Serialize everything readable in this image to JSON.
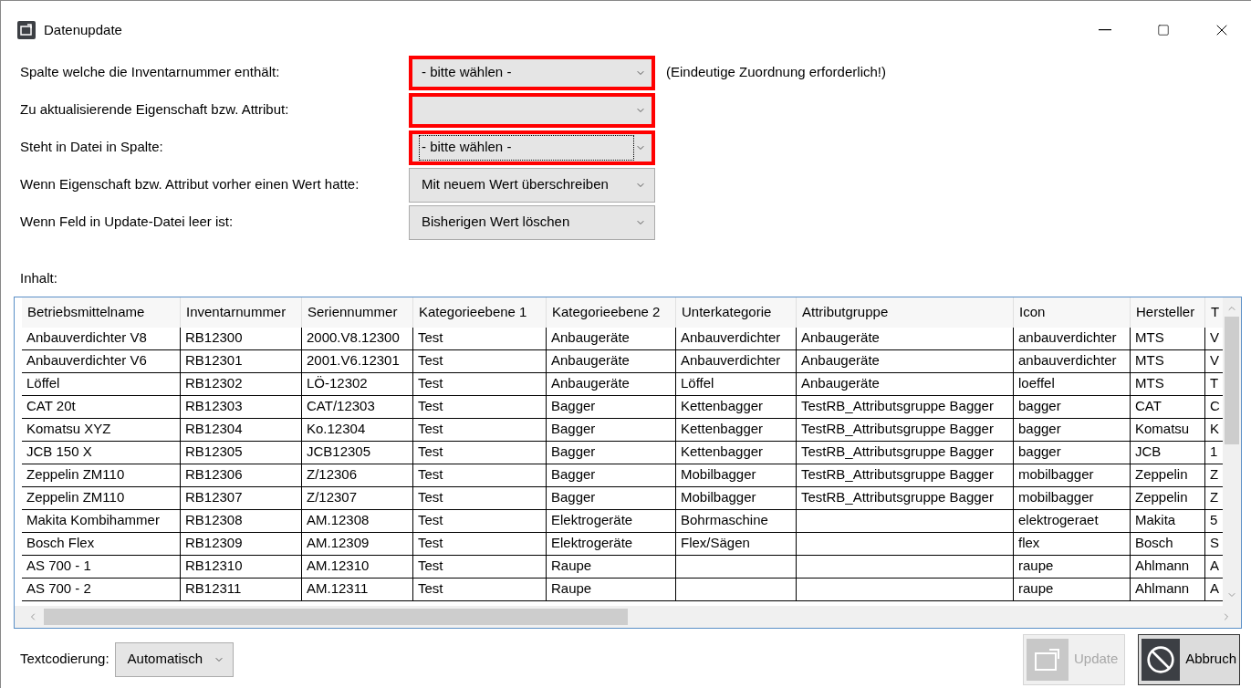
{
  "window": {
    "title": "Datenupdate"
  },
  "form": [
    {
      "label": "Spalte welche die Inventarnummer enthält:",
      "value": "- bitte wählen -",
      "invalid": true,
      "focused": false,
      "note": "(Eindeutige Zuordnung erforderlich!)"
    },
    {
      "label": "Zu aktualisierende Eigenschaft bzw. Attribut:",
      "invalid": true,
      "focused": false
    },
    {
      "label": "Steht in Datei in Spalte:",
      "value": "- bitte wählen -",
      "invalid": true,
      "focused": true
    },
    {
      "label": "Wenn Eigenschaft bzw. Attribut vorher einen Wert hatte:",
      "value": "Mit neuem Wert überschreiben",
      "invalid": false,
      "focused": false
    },
    {
      "label": "Wenn Feld in Update-Datei leer ist:",
      "value": "Bisherigen Wert löschen",
      "invalid": false,
      "focused": false
    }
  ],
  "content_label": "Inhalt:",
  "table": {
    "columns": [
      "Betriebsmittelname",
      "Inventarnummer",
      "Seriennummer",
      "Kategorieebene 1",
      "Kategorieebene 2",
      "Unterkategorie",
      "Attributgruppe",
      "Icon",
      "Hersteller",
      "T"
    ],
    "rows": [
      [
        "Anbauverdichter V8",
        "RB12300",
        "2000.V8.12300",
        "Test",
        "Anbaugeräte",
        "Anbauverdichter",
        "Anbaugeräte",
        "anbauverdichter",
        "MTS",
        "V"
      ],
      [
        "Anbauverdichter V6",
        "RB12301",
        "2001.V6.12301",
        "Test",
        "Anbaugeräte",
        "Anbauverdichter",
        "Anbaugeräte",
        "anbauverdichter",
        "MTS",
        "V"
      ],
      [
        "Löffel",
        "RB12302",
        "LÖ-12302",
        "Test",
        "Anbaugeräte",
        "Löffel",
        "Anbaugeräte",
        "loeffel",
        "MTS",
        "T"
      ],
      [
        "CAT 20t",
        "RB12303",
        "CAT/12303",
        "Test",
        "Bagger",
        "Kettenbagger",
        "TestRB_Attributsgruppe Bagger",
        "bagger",
        "CAT",
        "C"
      ],
      [
        "Komatsu XYZ",
        "RB12304",
        "Ko.12304",
        "Test",
        "Bagger",
        "Kettenbagger",
        "TestRB_Attributsgruppe Bagger",
        "bagger",
        "Komatsu",
        "K"
      ],
      [
        "JCB 150 X",
        "RB12305",
        "JCB12305",
        "Test",
        "Bagger",
        "Kettenbagger",
        "TestRB_Attributsgruppe Bagger",
        "bagger",
        "JCB",
        "1"
      ],
      [
        "Zeppelin ZM110",
        "RB12306",
        "Z/12306",
        "Test",
        "Bagger",
        "Mobilbagger",
        "TestRB_Attributsgruppe Bagger",
        "mobilbagger",
        "Zeppelin",
        "Z"
      ],
      [
        "Zeppelin ZM110",
        "RB12307",
        "Z/12307",
        "Test",
        "Bagger",
        "Mobilbagger",
        "TestRB_Attributsgruppe Bagger",
        "mobilbagger",
        "Zeppelin",
        "Z"
      ],
      [
        "Makita Kombihammer",
        "RB12308",
        "AM.12308",
        "Test",
        "Elektrogeräte",
        "Bohrmaschine",
        "",
        "elektrogeraet",
        "Makita",
        "5"
      ],
      [
        "Bosch Flex",
        "RB12309",
        "AM.12309",
        "Test",
        "Elektrogeräte",
        "Flex/Sägen",
        "",
        "flex",
        "Bosch",
        "S"
      ],
      [
        "AS 700 - 1",
        "RB12310",
        "AM.12310",
        "Test",
        "Raupe",
        "",
        "",
        "raupe",
        "Ahlmann",
        "A"
      ],
      [
        "AS 700 - 2",
        "RB12311",
        "AM.12311",
        "Test",
        "Raupe",
        "",
        "",
        "raupe",
        "Ahlmann",
        "A"
      ]
    ]
  },
  "encoding": {
    "label": "Textcodierung:",
    "value": "Automatisch"
  },
  "buttons": [
    {
      "label": "Update",
      "kind": "update",
      "disabled": true
    },
    {
      "label": "Abbruch",
      "kind": "cancel",
      "disabled": false
    }
  ]
}
